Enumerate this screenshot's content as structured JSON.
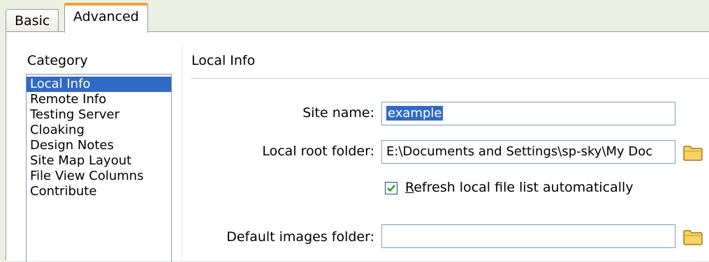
{
  "tabs": [
    {
      "label": "Basic",
      "active": false
    },
    {
      "label": "Advanced",
      "active": true
    }
  ],
  "category": {
    "title": "Category",
    "items": [
      {
        "label": "Local Info",
        "selected": true
      },
      {
        "label": "Remote Info",
        "selected": false
      },
      {
        "label": "Testing Server",
        "selected": false
      },
      {
        "label": "Cloaking",
        "selected": false
      },
      {
        "label": "Design Notes",
        "selected": false
      },
      {
        "label": "Site Map Layout",
        "selected": false
      },
      {
        "label": "File View Columns",
        "selected": false
      },
      {
        "label": "Contribute",
        "selected": false
      }
    ]
  },
  "section": {
    "title": "Local Info"
  },
  "form": {
    "site_name_label": "Site name:",
    "site_name_value": "example",
    "local_root_label": "Local root folder:",
    "local_root_value": "E:\\Documents and Settings\\sp-sky\\My Doc",
    "refresh_label": "Refresh local file list automatically",
    "refresh_checked": true,
    "default_images_label": "Default images folder:",
    "default_images_value": ""
  },
  "icons": {
    "local_root_browse": "folder-icon",
    "default_images_browse": "folder-icon"
  },
  "colors": {
    "selection": "#316ac5",
    "active_tab_accent": "#f0a030",
    "folder": "#f2c94c"
  }
}
